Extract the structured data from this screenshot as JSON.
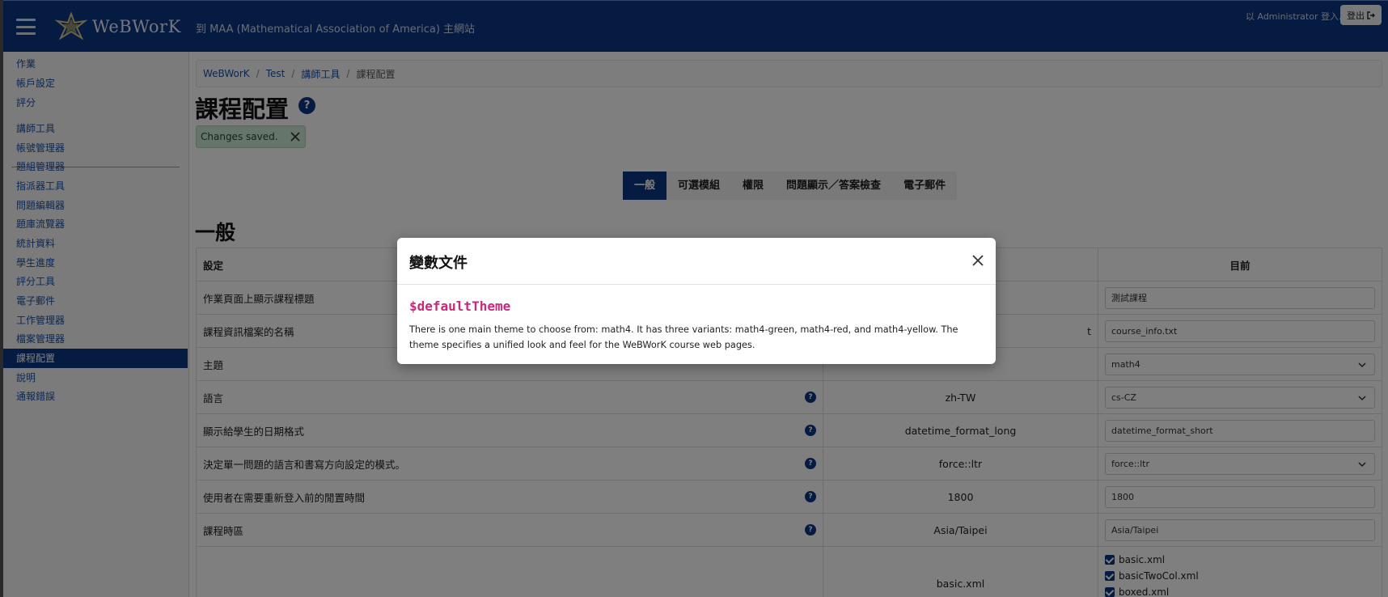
{
  "header": {
    "app_name": "WeBWorK",
    "maa_link": "到 MAA (Mathematical Association of America) 主網站",
    "user_info": "以 Administrator 登入.",
    "logout_label": "登出",
    "accent_color": "#0c3785"
  },
  "sidebar": {
    "items": [
      {
        "label": "作業"
      },
      {
        "label": "帳戶設定"
      },
      {
        "label": "評分"
      },
      {
        "label": "講師工具"
      },
      {
        "label": "帳號管理器"
      },
      {
        "label": "題組管理器"
      },
      {
        "label": "指派器工具"
      },
      {
        "label": "問題編輯器"
      },
      {
        "label": "題庫流覽器"
      },
      {
        "label": "統計資料"
      },
      {
        "label": "學生進度"
      },
      {
        "label": "評分工具"
      },
      {
        "label": "電子郵件"
      },
      {
        "label": "工作管理器"
      },
      {
        "label": "檔案管理器"
      },
      {
        "label": "課程配置"
      },
      {
        "label": "說明"
      },
      {
        "label": "通報錯誤"
      }
    ],
    "active_label": "課程配置"
  },
  "breadcrumb": {
    "items": [
      "WeBWorK",
      "Test",
      "講師工具"
    ],
    "current": "課程配置",
    "separator": "/"
  },
  "page": {
    "title": "課程配置",
    "help_icon": "question-circle-icon",
    "alert_text": "Changes saved."
  },
  "tabs": [
    "一般",
    "可選模組",
    "權限",
    "問題顯示／答案檢查",
    "電子郵件"
  ],
  "section_title": "一般",
  "table": {
    "header_setting": "設定",
    "header_current": "目前",
    "rows": [
      {
        "name": "作業頁面上顯示課程標題",
        "default": "",
        "current": "測試課程",
        "kind": "text"
      },
      {
        "name": "課程資訊檔案的名稱",
        "default": "t",
        "current": "course_info.txt",
        "kind": "text"
      },
      {
        "name": "主題",
        "default": "",
        "current": "math4",
        "kind": "select"
      },
      {
        "name": "語言",
        "default": "zh-TW",
        "current": "cs-CZ",
        "kind": "select"
      },
      {
        "name": "顯示給學生的日期格式",
        "default": "datetime_format_long",
        "current": "datetime_format_short",
        "kind": "text"
      },
      {
        "name": "決定單一問題的語言和書寫方向設定的模式。",
        "default": "force::ltr",
        "current": "force::ltr",
        "kind": "select"
      },
      {
        "name": "使用者在需要重新登入前的閒置時間",
        "default": "1800",
        "current": "1800",
        "kind": "text"
      },
      {
        "name": "課程時區",
        "default": "Asia/Taipei",
        "current": "Asia/Taipei",
        "kind": "text"
      }
    ],
    "hardcopy": {
      "default": "basic.xml",
      "checked_items": [
        "basic.xml",
        "basicTwoCol.xml",
        "boxed.xml"
      ]
    }
  },
  "modal": {
    "title": "變數文件",
    "variable": "$defaultTheme",
    "description": "There is one main theme to choose from: math4. It has three variants: math4-green, math4-red, and math4-yellow. The theme specifies a unified look and feel for the WeBWorK course web pages.",
    "variable_color": "#c9287b"
  }
}
